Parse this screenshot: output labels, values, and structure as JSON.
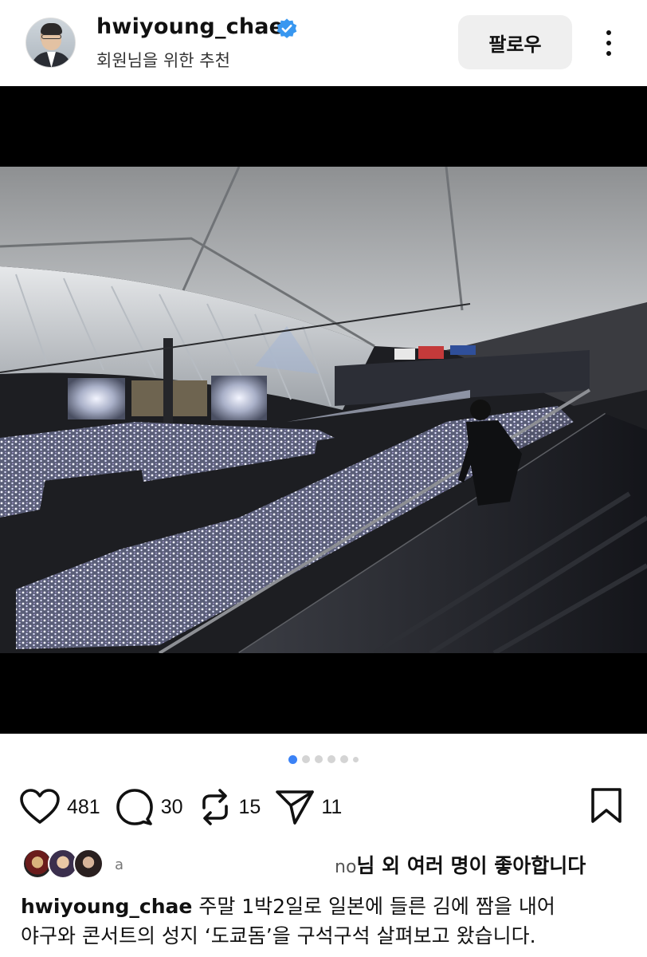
{
  "header": {
    "username": "hwiyoung_chae",
    "subtitle": "회원님을 위한 추천",
    "follow_label": "팔로우"
  },
  "colors": {
    "verified": "#3897f0",
    "dot_active": "#3b82f6",
    "dot_inactive": "#d4d4d4"
  },
  "carousel": {
    "total": 6,
    "active_index": 0
  },
  "actions": {
    "like_count": "481",
    "comment_count": "30",
    "repost_count": "15",
    "share_count": "11",
    "icons": [
      "heart-icon",
      "comment-icon",
      "repost-icon",
      "send-icon",
      "bookmark-icon"
    ]
  },
  "likes": {
    "blurred_prefix": "a",
    "blurred_suffix": "no",
    "text": "님 외 여러 명이 좋아합니다"
  },
  "caption": {
    "username": "hwiyoung_chae",
    "line1": " 주말 1박2일로 일본에 들른 김에 짬을 내어",
    "line2": "야구와 콘서트의 성지 ‘도쿄돔’을 구석구석 살펴보고 왔습니다."
  }
}
